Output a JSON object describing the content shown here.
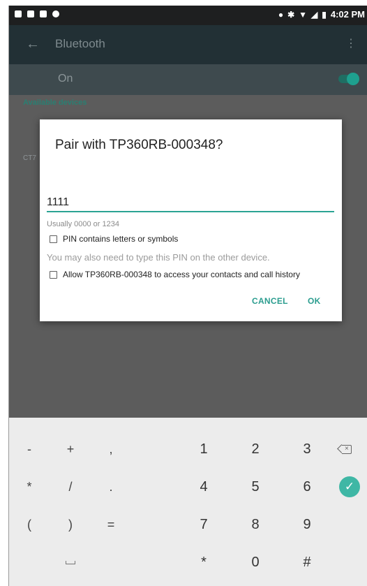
{
  "status_bar": {
    "time": "4:02 PM",
    "left_icons": [
      "image-icon",
      "sim-icon",
      "lock-icon",
      "android-icon"
    ],
    "right_icons": [
      "location-icon",
      "bluetooth-icon",
      "wifi-icon",
      "signal-icon",
      "battery-icon"
    ]
  },
  "app_bar": {
    "title": "Bluetooth",
    "back_icon": "arrow-back-icon",
    "menu_icon": "overflow-menu-icon"
  },
  "bluetooth_toggle": {
    "label": "On",
    "enabled": true,
    "accent": "#1ea08f"
  },
  "section": {
    "available_devices": "Available devices",
    "device_fragment": "CT7"
  },
  "dialog": {
    "title": "Pair with TP360RB-000348?",
    "pin_value": "1111",
    "hint": "Usually 0000 or 1234",
    "checkbox_pin_letters": {
      "label": "PIN contains letters or symbols",
      "checked": false
    },
    "note": "You may also need to type this PIN on the other device.",
    "checkbox_contacts": {
      "label": "Allow TP360RB-000348 to access your contacts and call history",
      "checked": false
    },
    "cancel_label": "CANCEL",
    "ok_label": "OK",
    "accent": "#2b9d8f"
  },
  "keyboard": {
    "rows": [
      [
        "-",
        "+",
        ",",
        "1",
        "2",
        "3",
        "backspace"
      ],
      [
        "*",
        "/",
        ".",
        "4",
        "5",
        "6",
        "done"
      ],
      [
        "(",
        ")",
        "=",
        "7",
        "8",
        "9",
        ""
      ],
      [
        "space",
        "",
        "",
        "*",
        "0",
        "#",
        ""
      ]
    ],
    "done_color": "#3fb7a5"
  }
}
